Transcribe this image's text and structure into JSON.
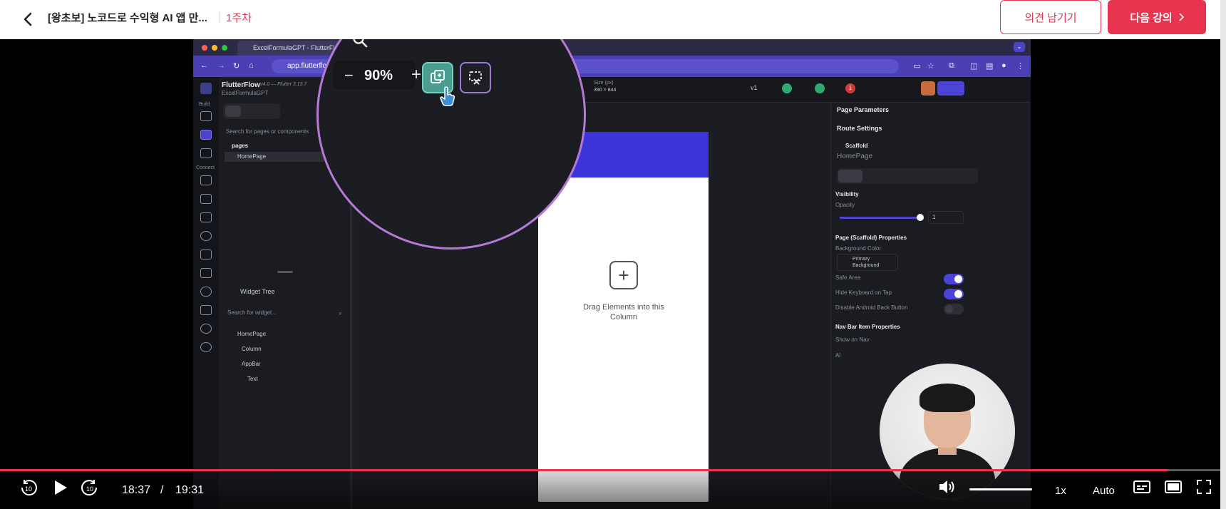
{
  "header": {
    "course_title": "[왕초보] 노코드로 수익형 AI 앱 만...",
    "week": "1주차",
    "feedback_label": "의견 남기기",
    "next_label": "다음 강의",
    "brand_color": "#e8344e"
  },
  "video": {
    "browser_tab": "ExcelFormulaGPT - FlutterFlo",
    "url": "app.flutterflo",
    "app_name": "FlutterFlow",
    "app_version": "v4.0 — Flutter 3.13.7",
    "project_name": "ExcelFormulaGPT",
    "search_pages": "Search for pages or components",
    "pages_label": "pages",
    "home_page": "HomePage",
    "widget_tree_label": "Widget Tree",
    "search_widget": "Search for widget...",
    "tree": [
      "HomePage",
      "Column",
      "AppBar",
      "Text"
    ],
    "build_label": "Build",
    "connect_label": "Connect",
    "size_label": "Size (px)",
    "size_value": "390 × 844",
    "version_label": "v1",
    "zoom_value": "90%",
    "zoom_minus": "−",
    "zoom_plus": "+",
    "appbar_partial": "e",
    "drag_text": "Drag Elements into this Column",
    "right_panel": {
      "page_parameters": "Page Parameters",
      "route_settings": "Route Settings",
      "scaffold": "Scaffold",
      "home_page": "HomePage",
      "visibility": "Visibility",
      "opacity": "Opacity",
      "opacity_value": "1",
      "page_props": "Page (Scaffold) Properties",
      "bg_color": "Background Color",
      "primary_bg": "Primary Background",
      "safe_area": "Safe Area",
      "hide_keyboard": "Hide Keyboard on Tap",
      "disable_back": "Disable Android Back Button",
      "nav_bar_props": "Nav Bar Item Properties",
      "show_on_nav": "Show on Nav",
      "also": "Al"
    },
    "notification_count": "1"
  },
  "player": {
    "current_time": "18:37",
    "separator": "/",
    "total_time": "19:31",
    "rewind_label": "10",
    "forward_label": "10",
    "speed": "1x",
    "quality": "Auto",
    "progress": 0.957
  }
}
